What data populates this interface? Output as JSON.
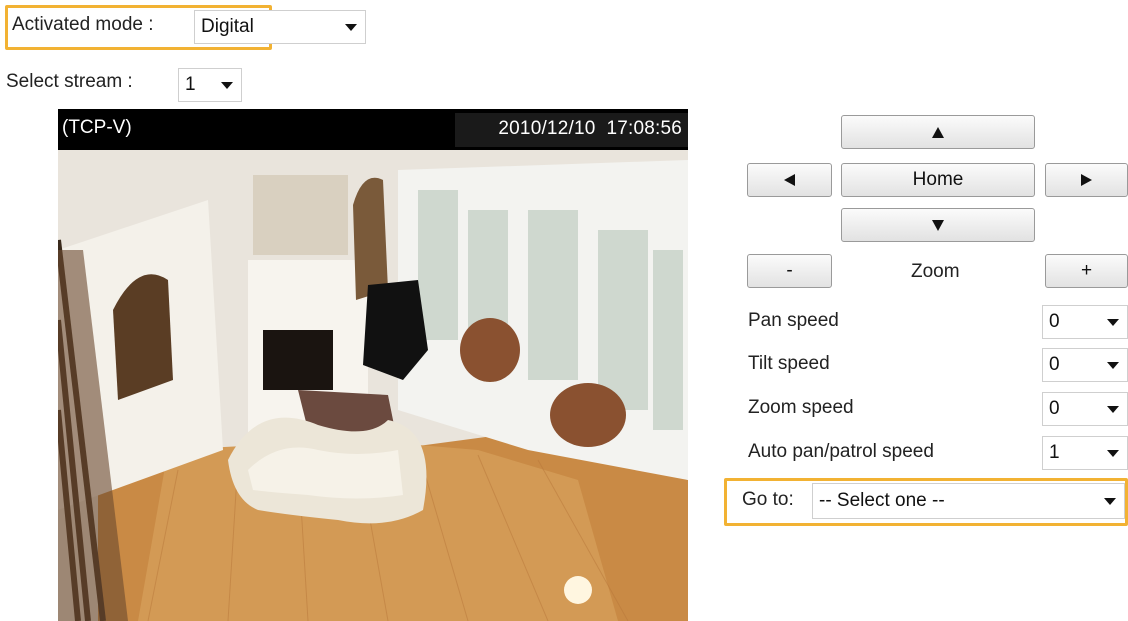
{
  "activated_mode": {
    "label": "Activated mode :",
    "value": "Digital"
  },
  "select_stream": {
    "label": "Select stream :",
    "value": "1"
  },
  "viewer": {
    "protocol": "(TCP-V)",
    "timestamp": "2010/12/10  17:08:56"
  },
  "ptz": {
    "home_label": "Home",
    "zoom_label": "Zoom",
    "zoom_out_label": "-",
    "zoom_in_label": "+"
  },
  "speeds": [
    {
      "label": "Pan speed",
      "value": "0"
    },
    {
      "label": "Tilt speed",
      "value": "0"
    },
    {
      "label": "Zoom speed",
      "value": "0"
    },
    {
      "label": "Auto pan/patrol speed",
      "value": "1"
    }
  ],
  "goto": {
    "label": "Go to:",
    "value": "-- Select one --"
  },
  "colors": {
    "highlight": "#f2b233",
    "viewer_bg": "#000000"
  }
}
